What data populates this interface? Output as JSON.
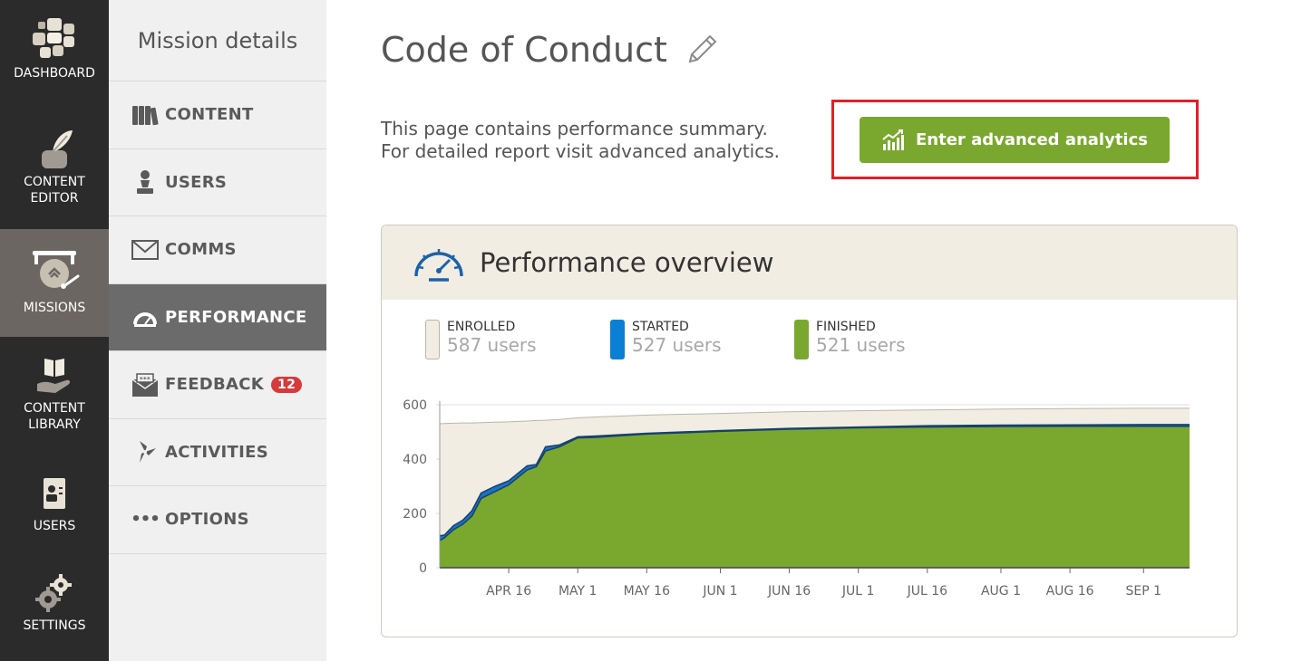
{
  "nav": {
    "items": [
      {
        "label": "DASHBOARD",
        "icon": "dashboard-icon"
      },
      {
        "label": "CONTENT\nEDITOR",
        "icon": "quill-icon"
      },
      {
        "label": "MISSIONS",
        "icon": "gong-icon",
        "active": true
      },
      {
        "label": "CONTENT\nLIBRARY",
        "icon": "book-hand-icon"
      },
      {
        "label": "USERS",
        "icon": "user-card-icon"
      },
      {
        "label": "SETTINGS",
        "icon": "gears-icon"
      }
    ]
  },
  "submenu": {
    "title": "Mission details",
    "items": [
      {
        "label": "CONTENT",
        "icon": "books-icon"
      },
      {
        "label": "USERS",
        "icon": "pawn-icon"
      },
      {
        "label": "COMMS",
        "icon": "envelope-icon"
      },
      {
        "label": "PERFORMANCE",
        "icon": "speedometer-icon",
        "active": true
      },
      {
        "label": "FEEDBACK",
        "icon": "rating-envelope-icon",
        "badge": "12"
      },
      {
        "label": "ACTIVITIES",
        "icon": "pinwheel-icon"
      },
      {
        "label": "OPTIONS",
        "icon": "dots-icon",
        "prefix": "•••"
      }
    ]
  },
  "page": {
    "title": "Code of Conduct",
    "desc_line1": "This page contains performance summary.",
    "desc_line2": "For detailed report visit advanced analytics.",
    "advanced_button": "Enter advanced analytics"
  },
  "panel": {
    "title": "Performance overview",
    "legend": [
      {
        "name": "ENROLLED",
        "value": "587 users",
        "color": "#f1ede3"
      },
      {
        "name": "STARTED",
        "value": "527 users",
        "color": "#0a7fd4"
      },
      {
        "name": "FINISHED",
        "value": "521 users",
        "color": "#7aa82f"
      }
    ]
  },
  "colors": {
    "accent_green": "#7aa82f",
    "started_blue": "#0a7fd4",
    "enrolled_beige": "#f1ede3",
    "badge_red": "#d63a3a",
    "highlight_red": "#e0202a"
  },
  "chart_data": {
    "type": "area",
    "ylim": [
      0,
      600
    ],
    "yticks": [
      0,
      200,
      400,
      600
    ],
    "xticks": [
      "APR 16",
      "MAY 1",
      "MAY 16",
      "JUN 1",
      "JUN 16",
      "JUL 1",
      "JUL 16",
      "AUG 1",
      "AUG 16",
      "SEP 1"
    ],
    "x": [
      "APR 1",
      "APR 2",
      "APR 4",
      "APR 6",
      "APR 8",
      "APR 10",
      "APR 13",
      "APR 16",
      "APR 20",
      "APR 22",
      "APR 24",
      "APR 27",
      "MAY 1",
      "MAY 5",
      "MAY 16",
      "JUN 1",
      "JUN 16",
      "JUL 1",
      "JUL 16",
      "AUG 1",
      "AUG 16",
      "SEP 1",
      "SEP 11"
    ],
    "series": [
      {
        "name": "ENROLLED",
        "values": [
          530,
          531,
          532,
          533,
          533,
          534,
          536,
          537,
          540,
          542,
          543,
          546,
          552,
          555,
          562,
          568,
          574,
          578,
          581,
          584,
          586,
          587,
          587
        ]
      },
      {
        "name": "STARTED",
        "values": [
          118,
          120,
          155,
          175,
          210,
          275,
          300,
          320,
          375,
          380,
          445,
          452,
          482,
          485,
          495,
          505,
          513,
          518,
          523,
          525,
          526,
          527,
          527
        ]
      },
      {
        "name": "FINISHED",
        "values": [
          100,
          110,
          140,
          160,
          190,
          255,
          280,
          305,
          360,
          372,
          430,
          445,
          478,
          480,
          492,
          502,
          510,
          515,
          518,
          520,
          521,
          521,
          521
        ]
      }
    ]
  }
}
